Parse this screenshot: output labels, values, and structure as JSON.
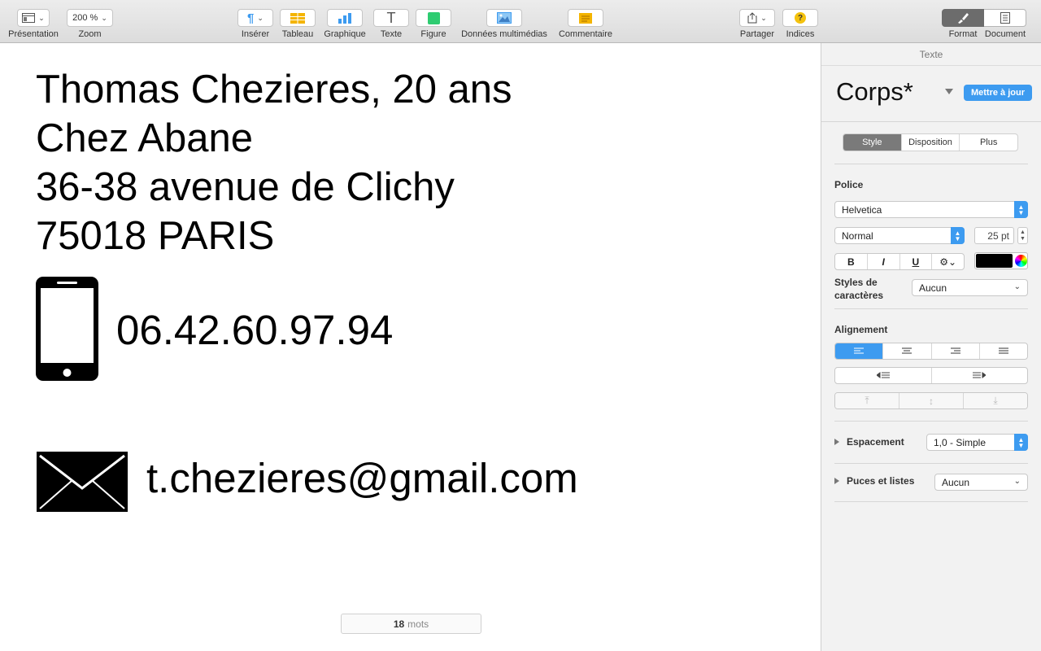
{
  "toolbar": {
    "presentation_label": "Présentation",
    "zoom_value": "200 %",
    "zoom_label": "Zoom",
    "insert_label": "Insérer",
    "table_label": "Tableau",
    "chart_label": "Graphique",
    "text_label": "Texte",
    "shape_label": "Figure",
    "media_label": "Données multimédias",
    "comment_label": "Commentaire",
    "share_label": "Partager",
    "tips_label": "Indices",
    "format_label": "Format",
    "document_label": "Document"
  },
  "document": {
    "lines": [
      "Thomas Chezieres, 20 ans",
      "Chez Abane",
      "36-38 avenue de Clichy",
      "75018 PARIS"
    ],
    "phone": "06.42.60.97.94",
    "email": "t.chezieres@gmail.com",
    "word_count": "18",
    "word_count_unit": "mots"
  },
  "inspector": {
    "header": "Texte",
    "paragraph_style": "Corps*",
    "update_button": "Mettre à jour",
    "tabs": [
      "Style",
      "Disposition",
      "Plus"
    ],
    "font_section": "Police",
    "font_family": "Helvetica",
    "font_typeface": "Normal",
    "font_size": "25 pt",
    "bold": "B",
    "italic": "I",
    "underline": "U",
    "text_color": "#000000",
    "char_styles_label": "Styles de caractères",
    "char_styles_value": "Aucun",
    "alignment_section": "Alignement",
    "spacing_label": "Espacement",
    "spacing_value": "1,0 - Simple",
    "bullets_label": "Puces et listes",
    "bullets_value": "Aucun"
  },
  "colors": {
    "accent": "#3d9bf0",
    "selected_tab": "#7a7a7a"
  }
}
